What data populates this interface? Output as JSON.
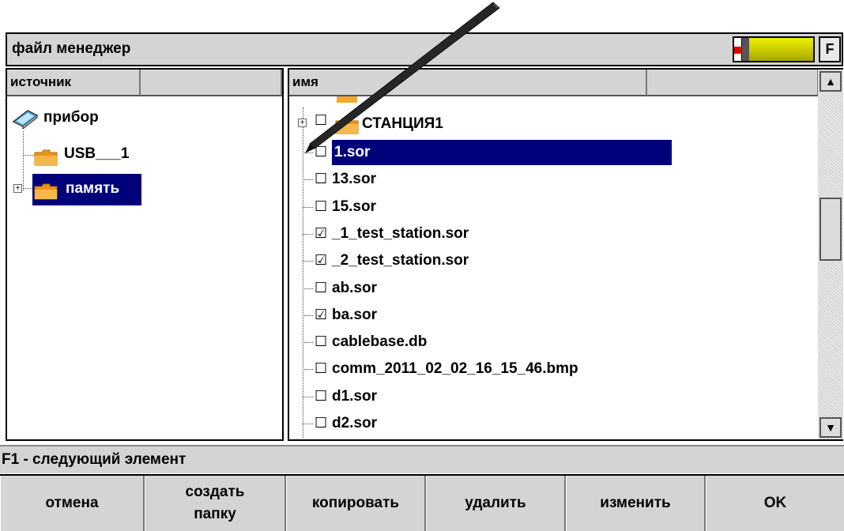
{
  "window": {
    "title": "файл менеджер",
    "function_key": "F"
  },
  "left_panel": {
    "header_source": "источник",
    "header_empty": "",
    "root": "прибор",
    "items": [
      {
        "label": "USB___1",
        "selected": false,
        "expandable": false
      },
      {
        "label": "память",
        "selected": true,
        "expandable": true
      }
    ]
  },
  "right_panel": {
    "header_name": "имя",
    "header_empty": "",
    "folder": {
      "label": "СТАНЦИЯ1",
      "checked": false
    },
    "files": [
      {
        "name": "1.sor",
        "checked": false,
        "selected": true
      },
      {
        "name": "13.sor",
        "checked": false,
        "selected": false
      },
      {
        "name": "15.sor",
        "checked": false,
        "selected": false
      },
      {
        "name": "_1_test_station.sor",
        "checked": true,
        "selected": false
      },
      {
        "name": "_2_test_station.sor",
        "checked": true,
        "selected": false
      },
      {
        "name": "ab.sor",
        "checked": false,
        "selected": false
      },
      {
        "name": "ba.sor",
        "checked": true,
        "selected": false
      },
      {
        "name": "cablebase.db",
        "checked": false,
        "selected": false
      },
      {
        "name": "comm_2011_02_02_16_15_46.bmp",
        "checked": false,
        "selected": false
      },
      {
        "name": "d1.sor",
        "checked": false,
        "selected": false
      },
      {
        "name": "d2.sor",
        "checked": false,
        "selected": false
      }
    ]
  },
  "status": "F1 - следующий элемент",
  "buttons": {
    "cancel": "отмена",
    "new_folder": "создать папку",
    "copy": "копировать",
    "delete": "удалить",
    "rename": "изменить",
    "ok": "OK"
  },
  "glyphs": {
    "unchecked": "☐",
    "checked": "☑",
    "scroll_up": "▲",
    "scroll_down": "▼",
    "expand": "+"
  },
  "colors": {
    "selection": "#00007a",
    "panel": "#d4d4d4",
    "folder": "#f5a623",
    "battery": "#d4d400"
  }
}
